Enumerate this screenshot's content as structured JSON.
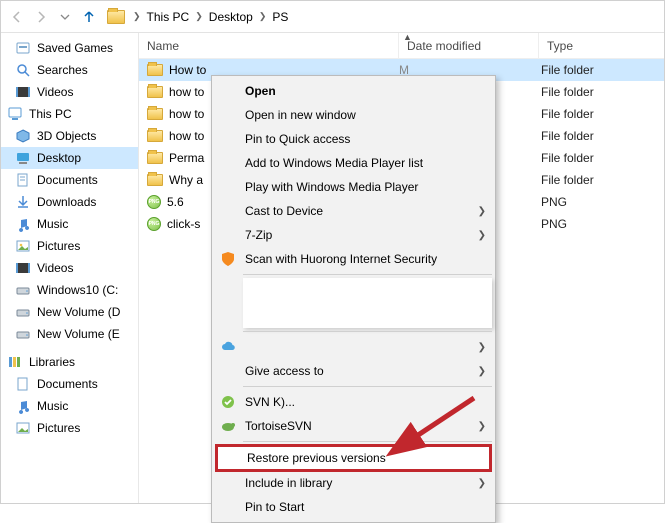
{
  "breadcrumb": {
    "seg1": "This PC",
    "seg2": "Desktop",
    "seg3": "PS"
  },
  "columns": {
    "name": "Name",
    "date": "Date modified",
    "type": "Type"
  },
  "nav": {
    "saved": "Saved Games",
    "searches": "Searches",
    "videos1": "Videos",
    "thispc": "This PC",
    "obj3d": "3D Objects",
    "desktop": "Desktop",
    "docs": "Documents",
    "downloads": "Downloads",
    "music": "Music",
    "pictures": "Pictures",
    "videos2": "Videos",
    "win10": "Windows10 (C:",
    "nv_d": "New Volume (D",
    "nv_e": "New Volume (E",
    "libraries": "Libraries",
    "ldocs": "Documents",
    "lmusic": "Music",
    "lpics": "Pictures"
  },
  "files": [
    {
      "name": "How to",
      "date": "M",
      "type": "File folder",
      "kind": "folder",
      "sel": true
    },
    {
      "name": "how to",
      "date": "",
      "type": "File folder",
      "kind": "folder"
    },
    {
      "name": "how to",
      "date": "",
      "type": "File folder",
      "kind": "folder"
    },
    {
      "name": "how to",
      "date": "",
      "type": "File folder",
      "kind": "folder"
    },
    {
      "name": "Perma",
      "date": "",
      "type": "File folder",
      "kind": "folder"
    },
    {
      "name": "Why a",
      "date": "",
      "type": "File folder",
      "kind": "folder"
    },
    {
      "name": "5.6",
      "date": "",
      "type": "PNG",
      "kind": "png"
    },
    {
      "name": "click-s",
      "date": "",
      "type": "PNG",
      "kind": "png"
    }
  ],
  "ctx": {
    "open": "Open",
    "open_new": "Open in new window",
    "pin_qa": "Pin to Quick access",
    "wmp_list": "Add to Windows Media Player list",
    "wmp_play": "Play with Windows Media Player",
    "cast": "Cast to Device",
    "sevenzip": "7-Zip",
    "huorong": "Scan with Huorong Internet Security",
    "cloud": "",
    "give_access": "Give access to",
    "svn": "SVN         K)...",
    "tortoise": "TortoiseSVN",
    "restore": "Restore previous versions",
    "include": "Include in library",
    "pin_start": "Pin to Start"
  }
}
